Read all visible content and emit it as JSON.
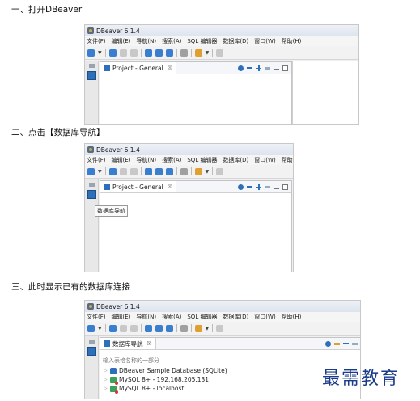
{
  "steps": [
    {
      "label": "一、打开DBeaver"
    },
    {
      "label": "二、点击【数据库导航】"
    },
    {
      "label": "三、此时显示已有的数据库连接"
    }
  ],
  "app": {
    "title": "DBeaver 6.1.4",
    "menu": [
      "文件(F)",
      "编辑(E)",
      "导航(N)",
      "搜索(A)",
      "SQL 编辑器",
      "数据库(D)",
      "窗口(W)",
      "帮助(H)"
    ]
  },
  "shot1": {
    "panel_tab": "Project - General"
  },
  "shot2": {
    "panel_tab": "Project - General",
    "tooltip": "数据库导航"
  },
  "shot3": {
    "panel_tab": "数据库导航",
    "filter_placeholder": "输入表格名称的一部分",
    "connections": [
      {
        "label": "DBeaver Sample Database (SQLite)",
        "icon": "sqlite-icon"
      },
      {
        "label": "MySQL 8+ - 192.168.205.131",
        "icon": "mysql-icon"
      },
      {
        "label": "MySQL 8+ - localhost",
        "icon": "mysql-icon"
      }
    ]
  },
  "watermark": "最需教育",
  "colors": {
    "accent": "#2d6fb8",
    "watermark": "#1a3a8a"
  }
}
